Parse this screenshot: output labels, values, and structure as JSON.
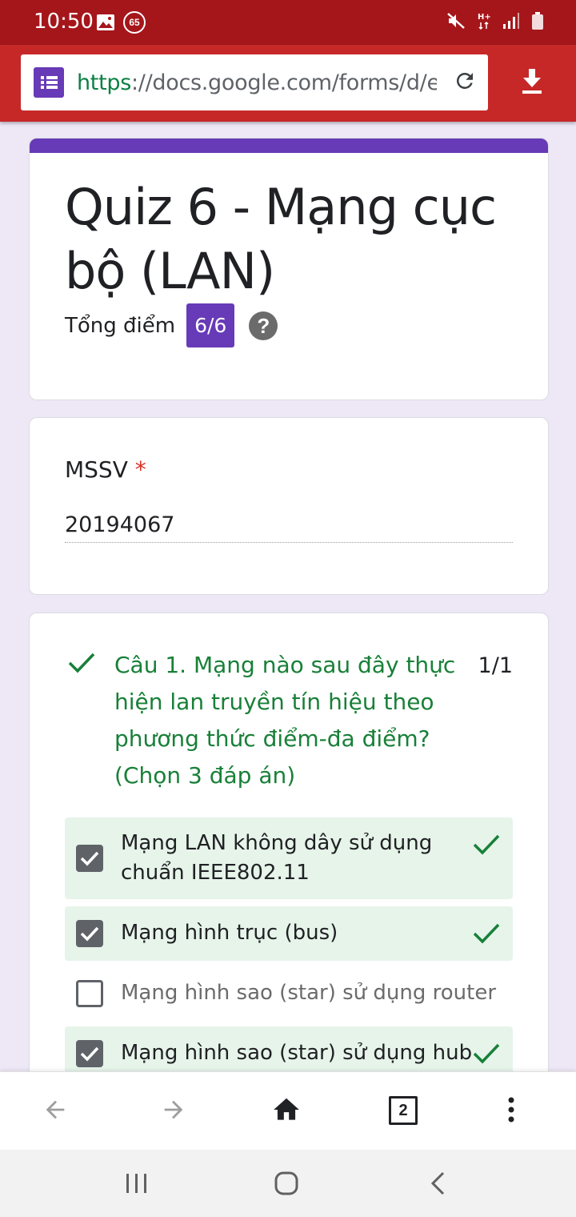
{
  "status_bar": {
    "time": "10:50",
    "notification_badge": "65"
  },
  "browser": {
    "url_scheme": "https",
    "url_rest": "://docs.google.com/forms/d/e/",
    "tab_count": "2"
  },
  "form": {
    "title": "Quiz 6 - Mạng cục bộ (LAN)",
    "score_label": "Tổng điểm",
    "score_value": "6/6",
    "help_glyph": "?"
  },
  "mssv": {
    "label": "MSSV",
    "required_mark": "*",
    "value": "20194067"
  },
  "question1": {
    "text": "Câu 1. Mạng nào sau đây thực hiện lan truyền tín hiệu theo phương thức điểm-đa điểm? (Chọn 3 đáp án)",
    "score": "1/1",
    "options": [
      {
        "label": "Mạng LAN không dây sử dụng chuẩn IEEE802.11",
        "checked": true,
        "correct": true
      },
      {
        "label": "Mạng hình trục (bus)",
        "checked": true,
        "correct": true
      },
      {
        "label": "Mạng hình sao (star) sử dụng router",
        "checked": false,
        "correct": false
      },
      {
        "label": "Mạng hình sao (star) sử dụng hub",
        "checked": true,
        "correct": true
      }
    ]
  },
  "colors": {
    "status_bar": "#a5161b",
    "toolbar": "#c62828",
    "accent": "#673ab7",
    "correct": "#188038",
    "correct_bg": "#e6f4ea"
  },
  "icons": [
    "image-icon",
    "mute-icon",
    "hplus-icon",
    "signal-icon",
    "battery-icon",
    "forms-icon",
    "reload-icon",
    "download-icon",
    "check-icon",
    "back-arrow-icon",
    "forward-arrow-icon",
    "home-icon",
    "more-icon",
    "recents-icon",
    "home-circle-icon",
    "system-back-icon"
  ]
}
